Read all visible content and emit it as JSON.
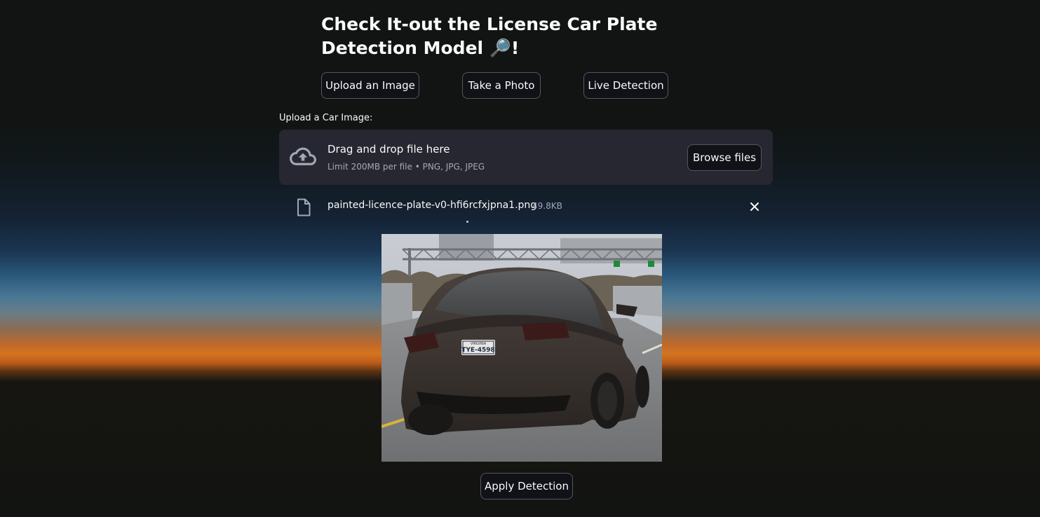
{
  "header": {
    "title": "Check It-out the License Car Plate Detection Model 🔎!"
  },
  "mode_buttons": {
    "upload": "Upload an Image",
    "photo": "Take a Photo",
    "live": "Live Detection"
  },
  "uploader": {
    "label": "Upload a Car Image:",
    "drop_title": "Drag and drop file here",
    "drop_subtitle": "Limit 200MB per file • PNG, JPG, JPEG",
    "browse_label": "Browse files",
    "upload_icon": "cloud-upload-icon"
  },
  "uploaded_file": {
    "name": "painted-licence-plate-v0-hfi6rcfxjpna1.png",
    "size": "49.8KB",
    "file_icon": "file-icon",
    "remove_icon": "close-icon"
  },
  "preview": {
    "plate_state": "VIRGINIA",
    "plate_number": "TYE-4598"
  },
  "actions": {
    "apply_label": "Apply Detection"
  },
  "colors": {
    "button_bg": "#101218",
    "dropzone_bg": "#262730",
    "text": "#fafafa",
    "muted_text": "#a3a8b8"
  }
}
